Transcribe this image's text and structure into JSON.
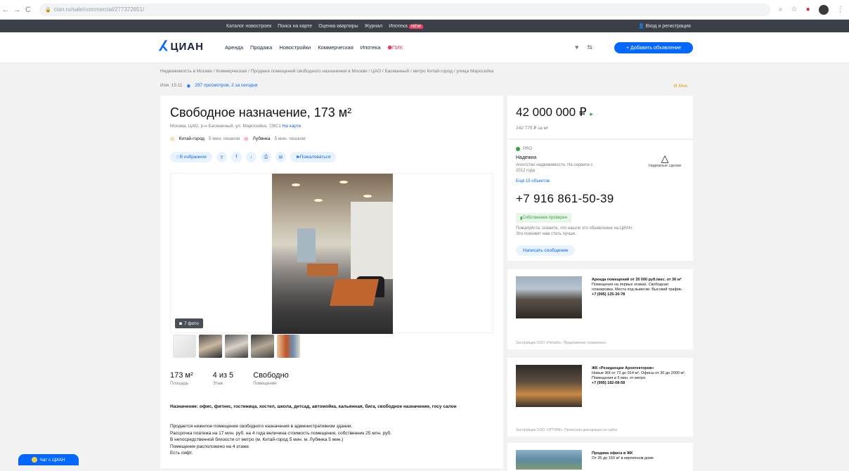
{
  "browser": {
    "url": "cian.ru/sale/commercial/277372651/",
    "back": "←",
    "forward": "→",
    "reload": "C",
    "lock": "🔒"
  },
  "topbar": {
    "links": [
      "Каталог новостроек",
      "Поиск на карте",
      "Оценка квартиры",
      "Журнал",
      "Ипотека"
    ],
    "new_badge": "NEW",
    "login": "Вход и регистрация"
  },
  "header": {
    "logo_text": "ЦИАН",
    "nav": [
      "Аренда",
      "Продажа",
      "Новостройки",
      "Коммерческая",
      "Ипотека"
    ],
    "nav_special": "ПИК",
    "add_button": "+ Добавить объявление"
  },
  "breadcrumbs": "Недвижимость в Москве  /  Коммерческая  /  Продажа помещений свободного назначения в Москве  /  ЦАО  /  Басманный  /  метро Китай-город  /  улица Маросейка",
  "subinfo": {
    "id": "Изм. 15:11",
    "views": "297 просмотров, 2 за сегодня"
  },
  "help": "Мне",
  "offer": {
    "title": "Свободное назначение, 173 м²",
    "address": "Москва, ЦАО, р-н Басманный, ул. Маросейка, 7/8С1",
    "map_link": "На карте",
    "metro": [
      {
        "name": "Китай-город",
        "time": "5 мин. пешком"
      },
      {
        "name": "Лубянка",
        "time": "5 мин. пешком"
      }
    ],
    "actions": {
      "favorite": "В избранное",
      "complain": "Пожаловаться"
    },
    "photo_count": "7 фото",
    "specs": [
      {
        "value": "173 м²",
        "label": "Площадь"
      },
      {
        "value": "4 из 5",
        "label": "Этаж"
      },
      {
        "value": "Свободно",
        "label": "Помещение"
      }
    ],
    "purpose": "Назначение: офис, фитнес, гостиница, хостел, школа, детсад, автомойка, кальянная, бига, свободное назначение, госу салон",
    "description": [
      "Продается нежилое помещение свободного назначения в административном здании.",
      "Рассрочка платежа на 17 млн. руб. на 4 года величина стоимость помещения, собственник 25 млн. руб.",
      "В непосредственной близости от метро (м. Китай-город 5 мин. м. Лубянка 5 мин.)",
      "Помещение расположено на 4 этаже.",
      "Есть лифт."
    ]
  },
  "price": {
    "value": "42 000 000 ₽",
    "per_meter": "242 775 ₽ за м²"
  },
  "contact": {
    "pro_label": "PRO",
    "agent_name": "Надежна",
    "agent_info": "Агентство недвижимости. На сервисе с 2012 года",
    "agent_more": "Ещё 15 объектов",
    "agent_logo_caption": "Надежные сделки",
    "phone": "+7 916 861-50-39",
    "verify_text": "Собственник проверен",
    "note": "Пожалуйста, скажите, что нашли это объявление на ЦИАН. Это поможет нам стать лучше.",
    "write_button": "Написать сообщение"
  },
  "ads": [
    {
      "title": "Аренда помещений от 35 000 руб./мес. от 36 м²",
      "text": "Помещения на первых этажах. Свободная планировка. Места под вывески. Высокий трафик.",
      "phone": "+7 (995) 125-30-78",
      "footer": "Застройщик ООО «Ритейл». Предложение ограничено."
    },
    {
      "title": "ЖК «Резиденции Архитекторов»",
      "text": "Новые ЖК от 72 до 914 м². Офисы от 30 до 2000 м². Помещения в 5 мин. от метро",
      "phone": "+7 (995) 182-08-58",
      "footer": "Застройщик ООО «ОПТИМ». Проектная декларация на сайте."
    },
    {
      "title": "Продажа офиса в ЖК",
      "text": "От 35 до 150 м² в кирпичном доме",
      "phone": "",
      "footer": ""
    }
  ],
  "chat_button": "Чат с ЦИАН"
}
